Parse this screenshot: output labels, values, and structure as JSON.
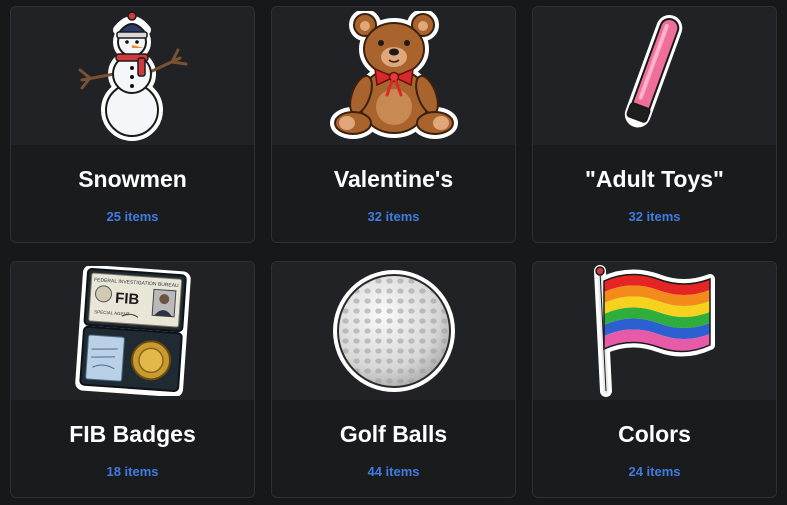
{
  "categories": [
    {
      "title": "Snowmen",
      "count": "25 items",
      "icon": "snowman-icon"
    },
    {
      "title": "Valentine's",
      "count": "32 items",
      "icon": "teddy-bear-icon"
    },
    {
      "title": "\"Adult Toys\"",
      "count": "32 items",
      "icon": "pink-toy-icon"
    },
    {
      "title": "FIB Badges",
      "count": "18 items",
      "icon": "badge-wallet-icon"
    },
    {
      "title": "Golf Balls",
      "count": "44 items",
      "icon": "golf-ball-icon"
    },
    {
      "title": "Colors",
      "count": "24 items",
      "icon": "rainbow-flag-icon"
    }
  ],
  "badge_text": {
    "bureau": "FEDERAL INVESTIGATION BUREAU",
    "logo": "FIB",
    "agent": "SPECIAL AGENT"
  },
  "colors": {
    "background": "#17181a",
    "card": "#1e1f22",
    "title": "#ffffff",
    "count": "#3f7be0"
  }
}
